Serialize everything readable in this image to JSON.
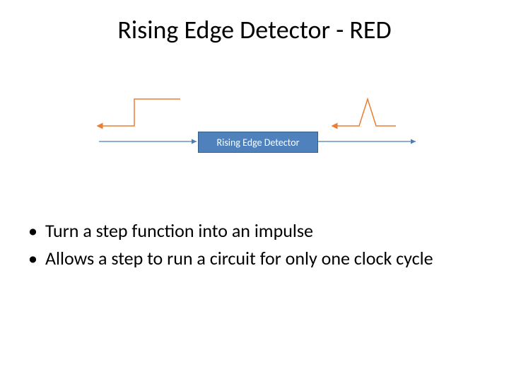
{
  "title": "Rising Edge Detector - RED",
  "block_label": "Rising Edge Detector",
  "bullets": [
    "Turn a step function into an impulse",
    "Allows a step to run a circuit for only one clock cycle"
  ],
  "colors": {
    "signal": "#ed7d31",
    "arrow_line": "#4a7ebb",
    "block_fill": "#4f81bd",
    "block_border": "#385d8a"
  }
}
